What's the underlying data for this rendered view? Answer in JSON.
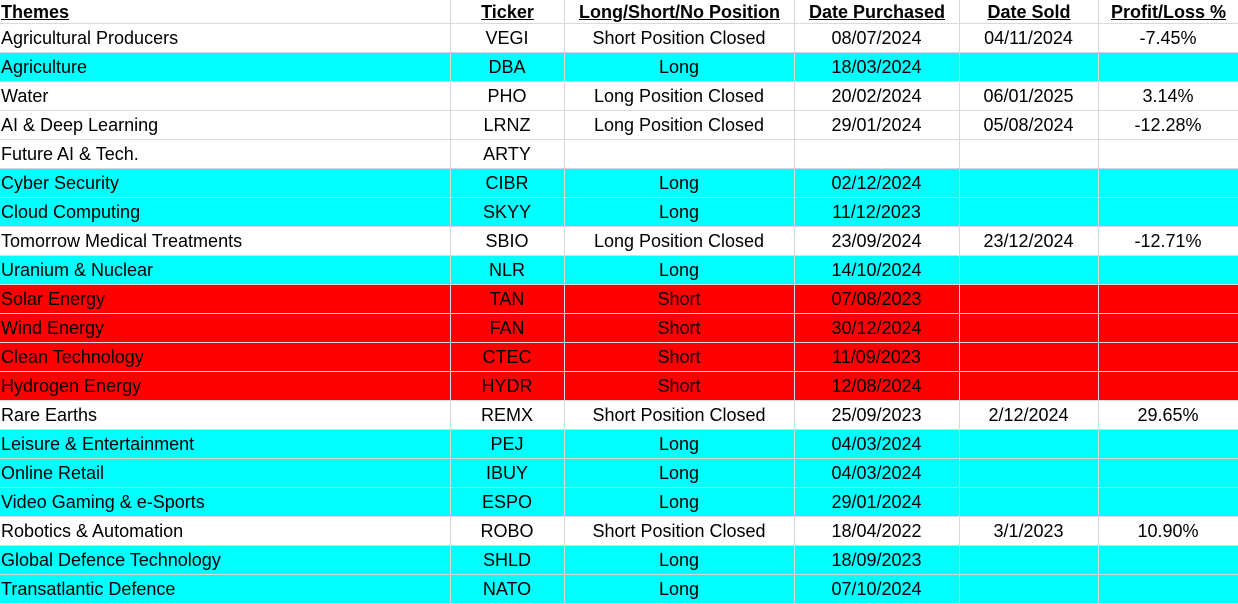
{
  "headers": [
    "Themes",
    "Ticker",
    "Long/Short/No Position",
    "Date Purchased",
    "Date Sold",
    "Profit/Loss %"
  ],
  "colors": {
    "cyan": "#00ffff",
    "red": "#ff0000",
    "white": "#ffffff",
    "gridline": "#d9d9d9"
  },
  "rows": [
    {
      "theme": "Agricultural Producers",
      "ticker": "VEGI",
      "position": "Short Position Closed",
      "date_purchased": "08/07/2024",
      "date_sold": "04/11/2024",
      "profit_loss": "-7.45%",
      "highlight": "white"
    },
    {
      "theme": "Agriculture",
      "ticker": "DBA",
      "position": "Long",
      "date_purchased": "18/03/2024",
      "date_sold": "",
      "profit_loss": "",
      "highlight": "cyan"
    },
    {
      "theme": "Water",
      "ticker": "PHO",
      "position": "Long Position Closed",
      "date_purchased": "20/02/2024",
      "date_sold": "06/01/2025",
      "profit_loss": "3.14%",
      "highlight": "white"
    },
    {
      "theme": "AI & Deep Learning",
      "ticker": "LRNZ",
      "position": "Long Position Closed",
      "date_purchased": "29/01/2024",
      "date_sold": "05/08/2024",
      "profit_loss": "-12.28%",
      "highlight": "white"
    },
    {
      "theme": "Future AI & Tech.",
      "ticker": "ARTY",
      "position": "",
      "date_purchased": "",
      "date_sold": "",
      "profit_loss": "",
      "highlight": "white"
    },
    {
      "theme": "Cyber Security",
      "ticker": "CIBR",
      "position": "Long",
      "date_purchased": "02/12/2024",
      "date_sold": "",
      "profit_loss": "",
      "highlight": "cyan"
    },
    {
      "theme": "Cloud Computing",
      "ticker": "SKYY",
      "position": "Long",
      "date_purchased": "11/12/2023",
      "date_sold": "",
      "profit_loss": "",
      "highlight": "cyan"
    },
    {
      "theme": "Tomorrow Medical Treatments",
      "ticker": "SBIO",
      "position": "Long Position Closed",
      "date_purchased": "23/09/2024",
      "date_sold": "23/12/2024",
      "profit_loss": "-12.71%",
      "highlight": "white"
    },
    {
      "theme": "Uranium & Nuclear",
      "ticker": "NLR",
      "position": "Long",
      "date_purchased": "14/10/2024",
      "date_sold": "",
      "profit_loss": "",
      "highlight": "cyan"
    },
    {
      "theme": "Solar Energy",
      "ticker": "TAN",
      "position": "Short",
      "date_purchased": "07/08/2023",
      "date_sold": "",
      "profit_loss": "",
      "highlight": "red"
    },
    {
      "theme": "Wind Energy",
      "ticker": "FAN",
      "position": "Short",
      "date_purchased": "30/12/2024",
      "date_sold": "",
      "profit_loss": "",
      "highlight": "red"
    },
    {
      "theme": "Clean Technology",
      "ticker": "CTEC",
      "position": "Short",
      "date_purchased": "11/09/2023",
      "date_sold": "",
      "profit_loss": "",
      "highlight": "red"
    },
    {
      "theme": "Hydrogen Energy",
      "ticker": "HYDR",
      "position": "Short",
      "date_purchased": "12/08/2024",
      "date_sold": "",
      "profit_loss": "",
      "highlight": "red"
    },
    {
      "theme": "Rare Earths",
      "ticker": "REMX",
      "position": "Short Position Closed",
      "date_purchased": "25/09/2023",
      "date_sold": "2/12/2024",
      "profit_loss": "29.65%",
      "highlight": "white"
    },
    {
      "theme": "Leisure & Entertainment",
      "ticker": "PEJ",
      "position": "Long",
      "date_purchased": "04/03/2024",
      "date_sold": "",
      "profit_loss": "",
      "highlight": "cyan"
    },
    {
      "theme": "Online Retail",
      "ticker": "IBUY",
      "position": "Long",
      "date_purchased": "04/03/2024",
      "date_sold": "",
      "profit_loss": "",
      "highlight": "cyan"
    },
    {
      "theme": "Video Gaming & e-Sports",
      "ticker": "ESPO",
      "position": "Long",
      "date_purchased": "29/01/2024",
      "date_sold": "",
      "profit_loss": "",
      "highlight": "cyan"
    },
    {
      "theme": "Robotics & Automation",
      "ticker": "ROBO",
      "position": "Short Position Closed",
      "date_purchased": "18/04/2022",
      "date_sold": "3/1/2023",
      "profit_loss": "10.90%",
      "highlight": "white"
    },
    {
      "theme": "Global Defence Technology",
      "ticker": "SHLD",
      "position": "Long",
      "date_purchased": "18/09/2023",
      "date_sold": "",
      "profit_loss": "",
      "highlight": "cyan"
    },
    {
      "theme": "Transatlantic Defence",
      "ticker": "NATO",
      "position": "Long",
      "date_purchased": "07/10/2024",
      "date_sold": "",
      "profit_loss": "",
      "highlight": "cyan"
    }
  ]
}
